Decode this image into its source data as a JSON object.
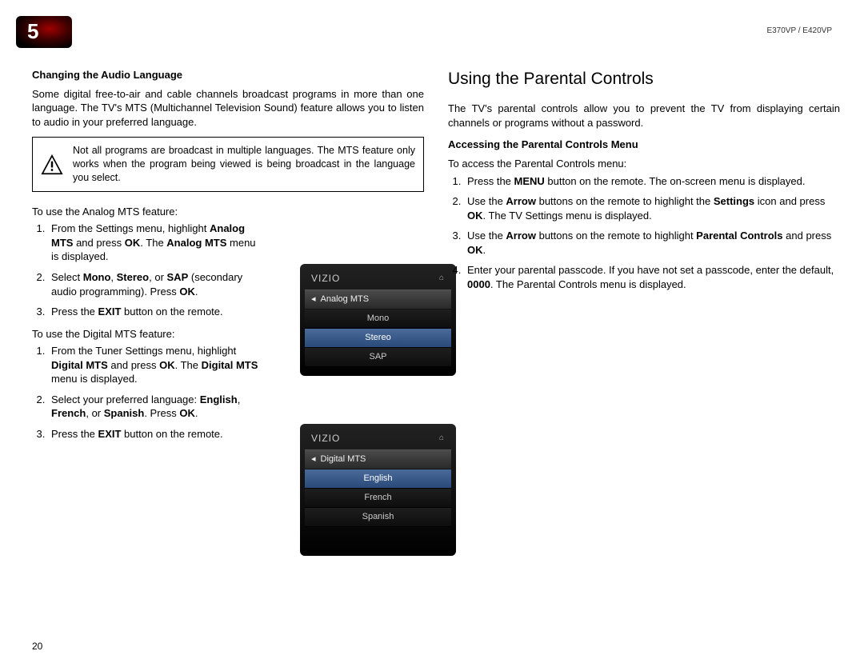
{
  "badge_number": "5",
  "model_id": "E370VP / E420VP",
  "page_footer": "20",
  "left": {
    "subheading": "Changing the Audio Language",
    "intro": "Some digital free-to-air and cable channels broadcast programs in more than one language. The TV's MTS (Multichannel Television Sound) feature allows you to listen to audio in your preferred language.",
    "note": "Not all programs are broadcast in multiple languages. The MTS feature only works when the program being viewed is being broadcast in the language you select.",
    "analog_intro": "To use the Analog MTS feature:",
    "analog_steps": [
      {
        "pre": "From the Settings menu, highlight ",
        "b1": "Analog MTS",
        "mid": " and press ",
        "b2": "OK",
        "post": ". The ",
        "b3": "Analog MTS",
        "tail": " menu is displayed."
      },
      {
        "pre": "Select ",
        "b1": "Mono",
        "sep1": ", ",
        "b2": "Stereo",
        "sep2": ", or ",
        "b3": "SAP",
        "post": " (secondary audio programming). Press ",
        "b4": "OK",
        "tail": "."
      },
      {
        "pre": "Press the ",
        "b1": "EXIT",
        "post": " button on the remote."
      }
    ],
    "digital_intro": "To use the Digital MTS feature:",
    "digital_steps": [
      {
        "pre": "From the Tuner Settings menu, highlight ",
        "b1": "Digital MTS",
        "mid": " and press ",
        "b2": "OK",
        "post": ". The ",
        "b3": "Digital MTS",
        "tail": " menu is displayed."
      },
      {
        "pre": "Select your preferred language: ",
        "b1": "English",
        "sep1": ", ",
        "b2": "French",
        "sep2": ", or ",
        "b3": "Spanish",
        "post": ". Press ",
        "b4": "OK",
        "tail": "."
      },
      {
        "pre": "Press the ",
        "b1": "EXIT",
        "post": " button on the remote."
      }
    ]
  },
  "tv1": {
    "brand": "VIZIO",
    "menu_title": "Analog MTS",
    "items": [
      "Mono",
      "Stereo",
      "SAP"
    ],
    "selected": "Stereo"
  },
  "tv2": {
    "brand": "VIZIO",
    "menu_title": "Digital MTS",
    "items": [
      "English",
      "French",
      "Spanish"
    ],
    "selected": "English"
  },
  "right": {
    "heading": "Using the Parental Controls",
    "intro": "The TV's parental controls allow you to prevent the TV from displaying certain channels or programs without a password.",
    "subheading": "Accessing the Parental Controls Menu",
    "access_intro": "To access the Parental Controls menu:",
    "steps": [
      {
        "pre": "Press the ",
        "b1": "MENU",
        "post": " button on the remote. The on-screen menu is displayed."
      },
      {
        "pre": "Use the ",
        "b1": "Arrow",
        "mid": " buttons on the remote to highlight the ",
        "b2": "Settings",
        "post": " icon and press ",
        "b3": "OK",
        "tail": ". The TV Settings menu is displayed."
      },
      {
        "pre": "Use the ",
        "b1": "Arrow",
        "mid": " buttons on the remote to highlight ",
        "b2": "Parental Controls",
        "post": " and press ",
        "b3": "OK",
        "tail": "."
      },
      {
        "pre": "Enter your parental passcode. If you have not set a passcode, enter the default, ",
        "b1": "0000",
        "post": ". The Parental Controls menu is displayed."
      }
    ]
  }
}
